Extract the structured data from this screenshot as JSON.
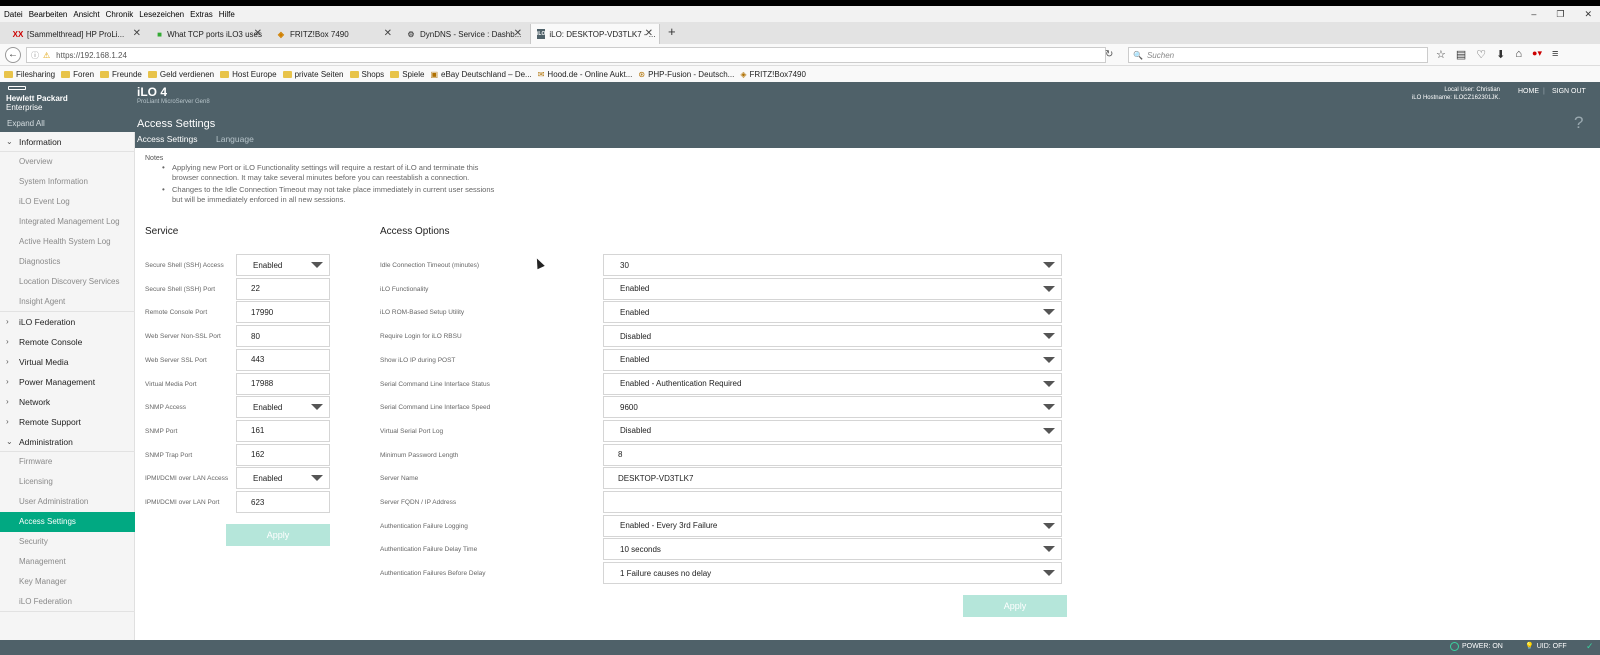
{
  "browser": {
    "menu": [
      "Datei",
      "Bearbeiten",
      "Ansicht",
      "Chronik",
      "Lesezeichen",
      "Extras",
      "Hilfe"
    ],
    "window_controls": [
      "–",
      "❐",
      "✕"
    ],
    "tabs": [
      {
        "label": "[Sammelthread] HP ProLi...",
        "icon": "XX"
      },
      {
        "label": "What TCP ports iLO3 uses",
        "icon": "■"
      },
      {
        "label": "FRITZ!Box 7490",
        "icon": "◈"
      },
      {
        "label": "DynDNS - Service : Dashb...",
        "icon": "⚙"
      },
      {
        "label": "iLO: DESKTOP-VD3TLK7 - ...",
        "icon": "iLO"
      }
    ],
    "new_tab": "+",
    "url_info_icon": "ⓘ",
    "url_warn_icon": "⚠",
    "url": "https://192.168.1.24",
    "search_placeholder": "Suchen",
    "search_icon": "🔍",
    "reload_icon": "↻",
    "back_icon": "←",
    "nav_icons": [
      "☆",
      "▤",
      "♡",
      "⬇",
      "⌂",
      "●▾",
      "≡"
    ],
    "bookmarks": [
      {
        "label": "Filesharing",
        "type": "folder"
      },
      {
        "label": "Foren",
        "type": "folder"
      },
      {
        "label": "Freunde",
        "type": "folder"
      },
      {
        "label": "Geld verdienen",
        "type": "folder"
      },
      {
        "label": "Host Europe",
        "type": "folder"
      },
      {
        "label": "private Seiten",
        "type": "folder"
      },
      {
        "label": "Shops",
        "type": "folder"
      },
      {
        "label": "Spiele",
        "type": "folder"
      },
      {
        "label": "eBay Deutschland – De...",
        "type": "link"
      },
      {
        "label": "Hood.de - Online Aukt...",
        "type": "link"
      },
      {
        "label": "PHP-Fusion - Deutsch...",
        "type": "link"
      },
      {
        "label": "FRITZ!Box7490",
        "type": "link"
      }
    ]
  },
  "header": {
    "brand_line1": "Hewlett Packard",
    "brand_line2": "Enterprise",
    "product": "iLO 4",
    "server_model": "ProLiant MicroServer Gen8",
    "user_line": "Local User: Christian",
    "hostname_line": "iLO Hostname: ILOCZ162301JK.",
    "home": "HOME",
    "separator": "|",
    "sign_out": "SIGN OUT",
    "page_title": "Access Settings",
    "help_icon": "?"
  },
  "sidebar": {
    "expand_all": "Expand All",
    "groups": [
      {
        "label": "Information",
        "expanded": true,
        "chevron": "⌄",
        "items": [
          "Overview",
          "System Information",
          "iLO Event Log",
          "Integrated Management Log",
          "Active Health System Log",
          "Diagnostics",
          "Location Discovery Services",
          "Insight Agent"
        ]
      },
      {
        "label": "iLO Federation",
        "expanded": false,
        "chevron": "›"
      },
      {
        "label": "Remote Console",
        "expanded": false,
        "chevron": "›"
      },
      {
        "label": "Virtual Media",
        "expanded": false,
        "chevron": "›"
      },
      {
        "label": "Power Management",
        "expanded": false,
        "chevron": "›"
      },
      {
        "label": "Network",
        "expanded": false,
        "chevron": "›"
      },
      {
        "label": "Remote Support",
        "expanded": false,
        "chevron": "›"
      },
      {
        "label": "Administration",
        "expanded": true,
        "chevron": "⌄",
        "items": [
          "Firmware",
          "Licensing",
          "User Administration",
          "Access Settings",
          "Security",
          "Management",
          "Key Manager",
          "iLO Federation"
        ]
      }
    ],
    "active_item": "Access Settings"
  },
  "subtabs": {
    "access": "Access Settings",
    "language": "Language"
  },
  "notes": {
    "label": "Notes",
    "bullet": "•",
    "items": [
      [
        "Applying new Port or iLO Functionality settings will require a restart of iLO and terminate this",
        "browser connection. It may take several minutes before you can reestablish a connection."
      ],
      [
        "Changes to the Idle Connection Timeout may not take place immediately in current user sessions",
        "but will be immediately enforced in all new sessions."
      ]
    ]
  },
  "service": {
    "title": "Service",
    "fields": [
      {
        "label": "Secure Shell (SSH) Access",
        "value": "Enabled",
        "type": "select"
      },
      {
        "label": "Secure Shell (SSH) Port",
        "value": "22",
        "type": "text"
      },
      {
        "label": "Remote Console Port",
        "value": "17990",
        "type": "text"
      },
      {
        "label": "Web Server Non-SSL Port",
        "value": "80",
        "type": "text"
      },
      {
        "label": "Web Server SSL Port",
        "value": "443",
        "type": "text"
      },
      {
        "label": "Virtual Media Port",
        "value": "17988",
        "type": "text"
      },
      {
        "label": "SNMP Access",
        "value": "Enabled",
        "type": "select"
      },
      {
        "label": "SNMP Port",
        "value": "161",
        "type": "text"
      },
      {
        "label": "SNMP Trap Port",
        "value": "162",
        "type": "text"
      },
      {
        "label": "IPMI/DCMI over LAN Access",
        "value": "Enabled",
        "type": "select"
      },
      {
        "label": "IPMI/DCMI over LAN Port",
        "value": "623",
        "type": "text"
      }
    ],
    "apply": "Apply"
  },
  "access_options": {
    "title": "Access Options",
    "fields": [
      {
        "label": "Idle Connection Timeout (minutes)",
        "value": "30",
        "type": "select"
      },
      {
        "label": "iLO Functionality",
        "value": "Enabled",
        "type": "select"
      },
      {
        "label": "iLO ROM-Based Setup Utility",
        "value": "Enabled",
        "type": "select"
      },
      {
        "label": "Require Login for iLO RBSU",
        "value": "Disabled",
        "type": "select"
      },
      {
        "label": "Show iLO IP during POST",
        "value": "Enabled",
        "type": "select"
      },
      {
        "label": "Serial Command Line Interface Status",
        "value": "Enabled - Authentication Required",
        "type": "select"
      },
      {
        "label": "Serial Command Line Interface Speed",
        "value": "9600",
        "type": "select"
      },
      {
        "label": "Virtual Serial Port Log",
        "value": "Disabled",
        "type": "select"
      },
      {
        "label": "Minimum Password Length",
        "value": "8",
        "type": "text"
      },
      {
        "label": "Server Name",
        "value": "DESKTOP-VD3TLK7",
        "type": "text"
      },
      {
        "label": "Server FQDN / IP Address",
        "value": "",
        "type": "text"
      },
      {
        "label": "Authentication Failure Logging",
        "value": "Enabled - Every 3rd Failure",
        "type": "select"
      },
      {
        "label": "Authentication Failure Delay Time",
        "value": "10 seconds",
        "type": "select"
      },
      {
        "label": "Authentication Failures Before Delay",
        "value": "1 Failure causes no delay",
        "type": "select"
      }
    ],
    "apply": "Apply"
  },
  "status": {
    "power": "POWER: ON",
    "uid": "UID: OFF",
    "check_icon": "✓",
    "uid_icon": "💡"
  },
  "colors": {
    "header_bg": "#4f6169",
    "active_green": "#01a982",
    "apply_disabled": "#b5e6da"
  }
}
